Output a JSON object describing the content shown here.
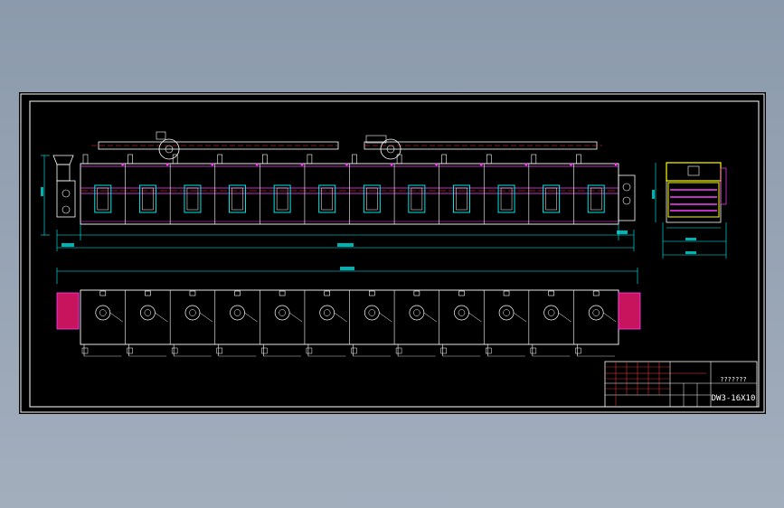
{
  "app": {
    "background_color": "#8b9aac",
    "sheet_color": "#000000"
  },
  "drawing": {
    "section_count": 12,
    "line_colors": {
      "outline": "#ffffff",
      "conveyor": "#ff40ff",
      "centerline": "#ff3030",
      "dimension": "#00ffff",
      "panel": "#00ffff",
      "side_view_highlight": "#ffff00",
      "end_plate": "#c8145c"
    }
  },
  "title_block": {
    "drawing_name": "???????",
    "drawing_number": "DW3-16X10"
  }
}
